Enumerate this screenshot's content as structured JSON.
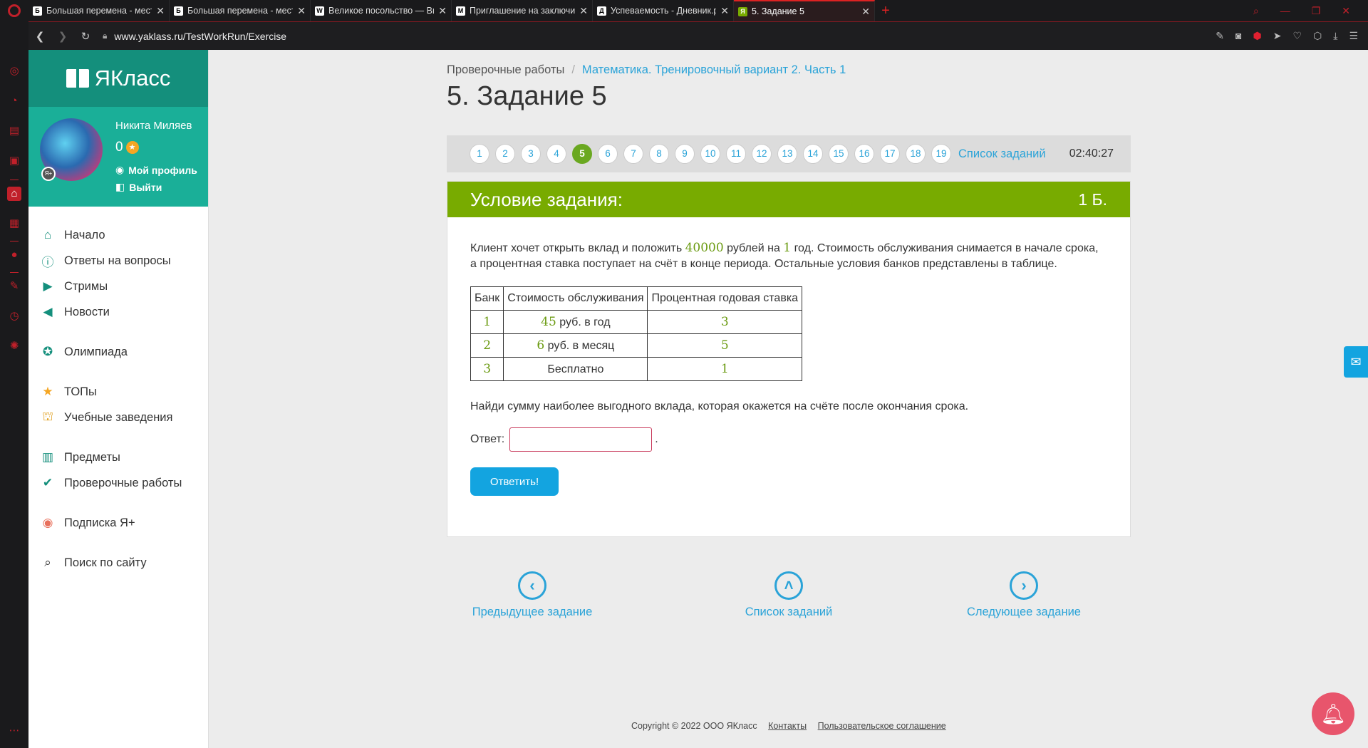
{
  "browser": {
    "tabs": [
      {
        "title": "Большая перемена - мест",
        "favicon": "Б",
        "active": false
      },
      {
        "title": "Большая перемена - мест",
        "favicon": "Б",
        "active": false
      },
      {
        "title": "Великое посольство — Ви",
        "favicon": "W",
        "active": false
      },
      {
        "title": "Приглашение на заключи",
        "favicon": "M",
        "active": false
      },
      {
        "title": "Успеваемость - Дневник.р",
        "favicon": "Д",
        "active": false
      },
      {
        "title": "5. Задание 5",
        "favicon": "Я",
        "active": true
      }
    ],
    "new_tab": "+",
    "url": "www.yaklass.ru/TestWorkRun/Exercise"
  },
  "sidebar": {
    "logo": "ЯКласс",
    "user_name": "Никита Миляев",
    "points": "0",
    "profile_link": "Мой профиль",
    "logout_link": "Выйти",
    "menu": [
      {
        "label": "Начало",
        "icon": "home-icon"
      },
      {
        "label": "Ответы на вопросы",
        "icon": "question-icon"
      },
      {
        "label": "Стримы",
        "icon": "play-icon"
      },
      {
        "label": "Новости",
        "icon": "megaphone-icon"
      },
      {
        "label": "Олимпиада",
        "icon": "medal-icon"
      },
      {
        "label": "ТОПы",
        "icon": "star-icon"
      },
      {
        "label": "Учебные заведения",
        "icon": "school-icon"
      },
      {
        "label": "Предметы",
        "icon": "books-icon"
      },
      {
        "label": "Проверочные работы",
        "icon": "check-circle-icon"
      },
      {
        "label": "Подписка Я+",
        "icon": "subscription-icon"
      },
      {
        "label": "Поиск по сайту",
        "icon": "search-icon"
      }
    ]
  },
  "main": {
    "breadcrumb": {
      "root": "Проверочные работы",
      "sep": "/",
      "current": "Математика. Тренировочный вариант 2. Часть 1"
    },
    "title": "5. Задание 5",
    "task_numbers": [
      "1",
      "2",
      "3",
      "4",
      "5",
      "6",
      "7",
      "8",
      "9",
      "10",
      "11",
      "12",
      "13",
      "14",
      "15",
      "16",
      "17",
      "18",
      "19"
    ],
    "current_task": "5",
    "task_list_link": "Список заданий",
    "timer": "02:40:27",
    "card": {
      "header": "Условие задания:",
      "score": "1 Б.",
      "text": {
        "p1": "Клиент хочет открыть вклад и положить ",
        "amount": "40000",
        "p2": " рублей на ",
        "years": "1",
        "p3": " год. Стоимость обслуживания снимается в начале срока, а процентная ставка поступает на счёт в конце периода. Остальные условия банков представлены в таблице."
      },
      "table": {
        "headers": [
          "Банк",
          "Стоимость обслуживания",
          "Процентная годовая ставка"
        ],
        "rows": [
          {
            "bank": "1",
            "cost_num": "45",
            "cost_text": " руб. в год",
            "rate": "3"
          },
          {
            "bank": "2",
            "cost_num": "6",
            "cost_text": " руб. в месяц",
            "rate": "5"
          },
          {
            "bank": "3",
            "cost_num": "",
            "cost_text": "Бесплатно",
            "rate": "1"
          }
        ]
      },
      "question": "Найди сумму наиболее выгодного вклада, которая окажется на счёте после окончания срока.",
      "answer_label": "Ответ:",
      "answer_value": "",
      "answer_dot": ".",
      "submit": "Ответить!"
    },
    "bottom_nav": {
      "prev": "Предыдущее задание",
      "list": "Список заданий",
      "next": "Следующее задание"
    }
  },
  "footer": {
    "copyright": "Copyright © 2022 ООО ЯКласс",
    "contacts": "Контакты",
    "agreement": "Пользовательское соглашение"
  },
  "colors": {
    "brand_teal": "#148f7c",
    "task_green": "#78ab00",
    "link_blue": "#2aa3d8",
    "button_blue": "#13a4e0"
  }
}
